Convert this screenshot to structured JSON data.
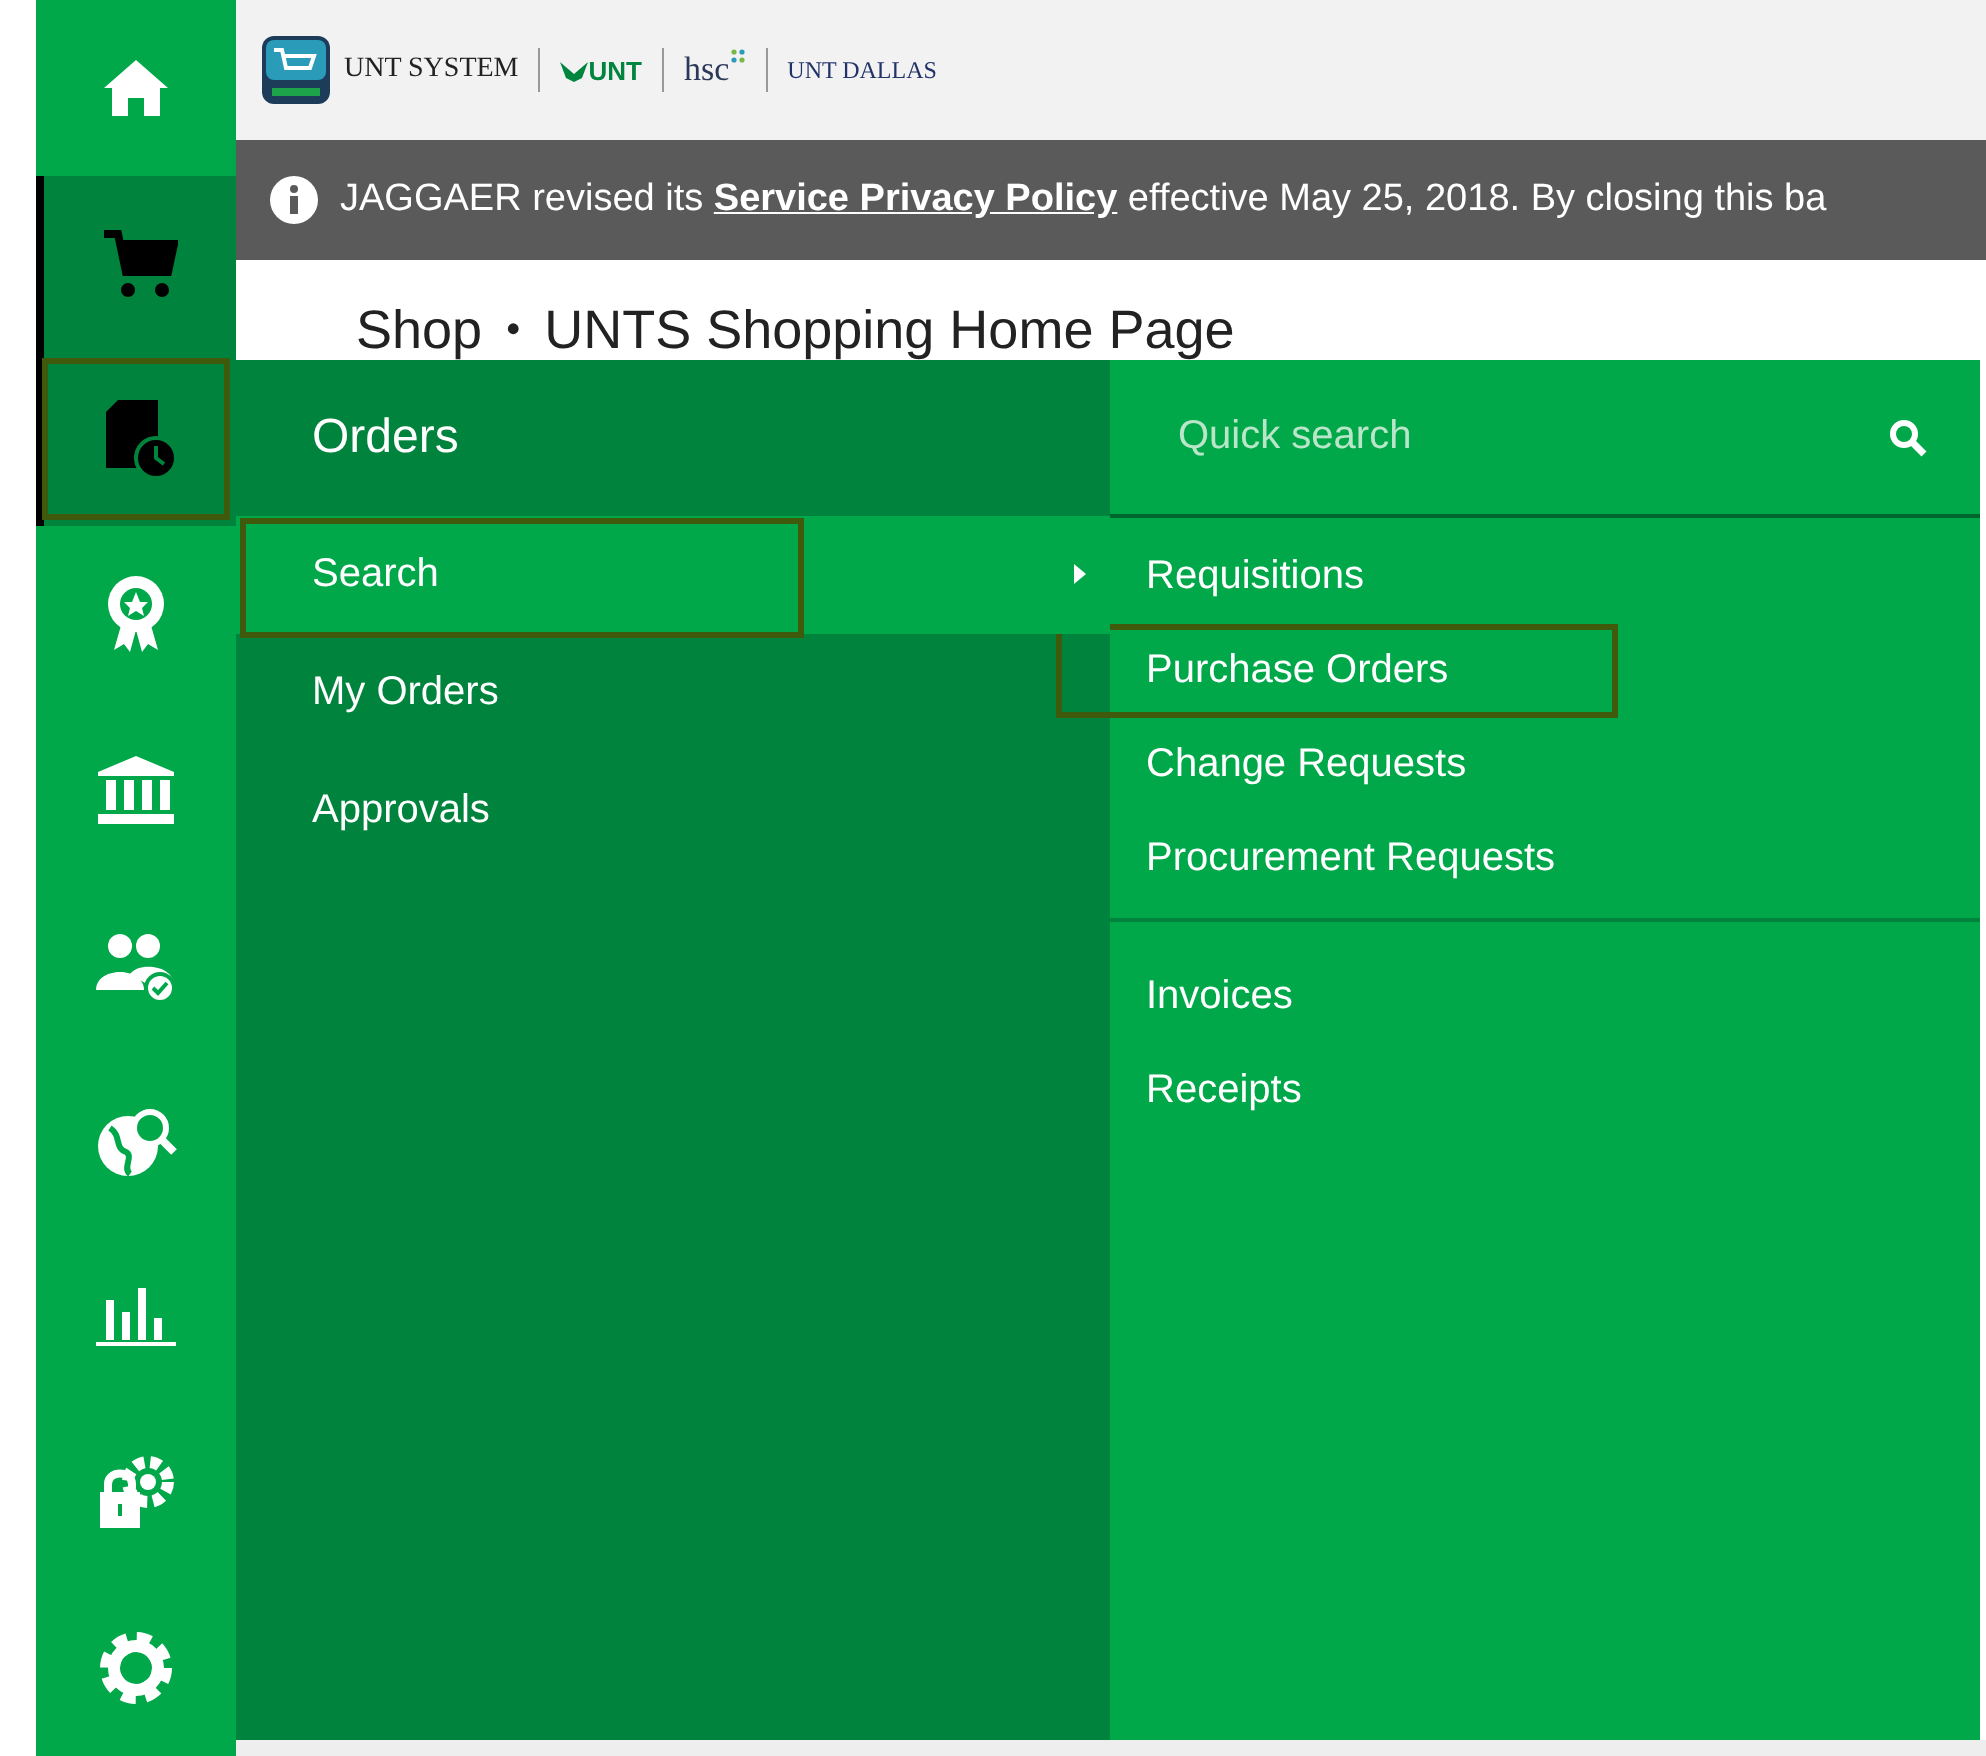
{
  "header": {
    "logos": [
      {
        "kind": "system",
        "label": "UNT SYSTEM"
      },
      {
        "kind": "unt",
        "label": "UNT"
      },
      {
        "kind": "hsc",
        "label": "hsc"
      },
      {
        "kind": "dallas",
        "label": "UNT DALLAS"
      }
    ]
  },
  "banner": {
    "before": "JAGGAER revised its",
    "link": "Service Privacy Policy",
    "after": "effective May 25, 2018. By closing this ba"
  },
  "breadcrumb": {
    "section": "Shop",
    "separator": "•",
    "page": "UNTS Shopping Home Page"
  },
  "sidebar": {
    "items": [
      {
        "kind": "home",
        "active": false,
        "highlighted": false
      },
      {
        "kind": "cart",
        "active": true,
        "highlighted": false
      },
      {
        "kind": "orders",
        "active": true,
        "highlighted": true
      },
      {
        "kind": "award",
        "active": false,
        "highlighted": false
      },
      {
        "kind": "bank",
        "active": false,
        "highlighted": false
      },
      {
        "kind": "users",
        "active": false,
        "highlighted": false
      },
      {
        "kind": "globe",
        "active": false,
        "highlighted": false
      },
      {
        "kind": "chart",
        "active": false,
        "highlighted": false
      },
      {
        "kind": "lock",
        "active": false,
        "highlighted": false
      },
      {
        "kind": "gear",
        "active": false,
        "highlighted": false
      }
    ]
  },
  "flyout": {
    "title": "Orders",
    "items": [
      {
        "label": "Search",
        "selected": true,
        "highlighted": true
      },
      {
        "label": "My Orders",
        "selected": false,
        "highlighted": false
      },
      {
        "label": "Approvals",
        "selected": false,
        "highlighted": false
      }
    ],
    "quick_search": {
      "placeholder": "Quick search"
    },
    "groups": [
      [
        {
          "label": "Requisitions",
          "highlighted": false
        },
        {
          "label": "Purchase Orders",
          "highlighted": true
        },
        {
          "label": "Change Requests",
          "highlighted": false
        },
        {
          "label": "Procurement Requests",
          "highlighted": false
        }
      ],
      [
        {
          "label": "Invoices",
          "highlighted": false
        },
        {
          "label": "Receipts",
          "highlighted": false
        }
      ]
    ]
  }
}
